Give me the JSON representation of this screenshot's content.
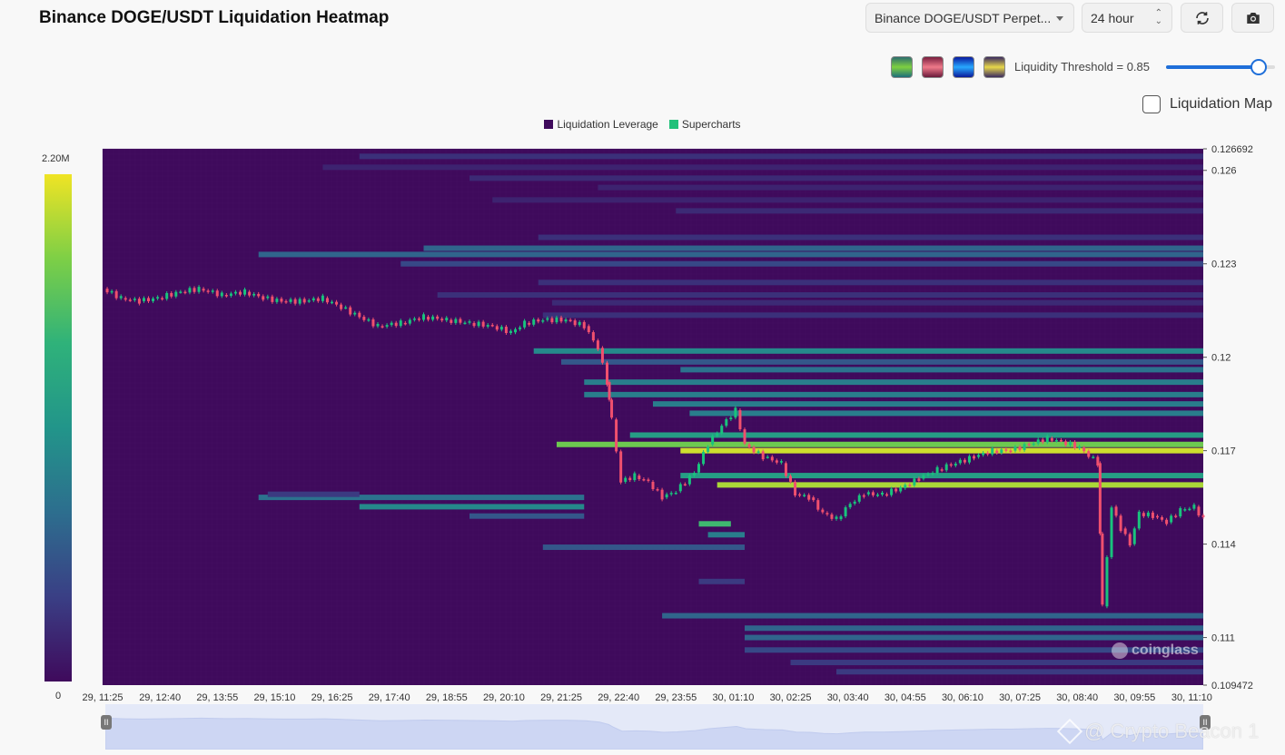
{
  "header": {
    "title": "Binance DOGE/USDT Liquidation Heatmap",
    "symbol_select": "Binance DOGE/USDT Perpet...",
    "range_select": "24 hour",
    "refresh_icon": "refresh-icon",
    "camera_icon": "camera-icon"
  },
  "controls": {
    "palette_swatches": [
      "viridis-palette",
      "red-palette",
      "blue-palette",
      "yellow-palette"
    ],
    "threshold_label": "Liquidity Threshold = 0.85",
    "threshold_value": 0.85,
    "liquidation_map_label": "Liquidation Map",
    "liquidation_map_checked": false
  },
  "colorbar": {
    "max_label": "2.20M",
    "min_label": "0",
    "max_value": 2200000,
    "min_value": 0
  },
  "watermark": "coinglass",
  "credit": "@ Crypto Beacon 1",
  "chart_data": {
    "type": "heatmap",
    "title": "Binance DOGE/USDT Liquidation Heatmap",
    "legend": [
      {
        "name": "Liquidation Leverage",
        "color": "#3f0a5c"
      },
      {
        "name": "Supercharts",
        "color": "#22c17a"
      }
    ],
    "legend_position": "top-center",
    "x_ticks": [
      "29, 11:25",
      "29, 12:40",
      "29, 13:55",
      "29, 15:10",
      "29, 16:25",
      "29, 17:40",
      "29, 18:55",
      "29, 20:10",
      "29, 21:25",
      "29, 22:40",
      "29, 23:55",
      "30, 01:10",
      "30, 02:25",
      "30, 03:40",
      "30, 04:55",
      "30, 06:10",
      "30, 07:25",
      "30, 08:40",
      "30, 09:55",
      "30, 11:10"
    ],
    "y_ticks": [
      "0.126692",
      "0.126",
      "0.123",
      "0.12",
      "0.117",
      "0.114",
      "0.111",
      "0.109472"
    ],
    "ylim": [
      0.109472,
      0.126692
    ],
    "x_range_hours": [
      0,
      24
    ],
    "colorscale": [
      "#3f0a5c",
      "#3a3f85",
      "#2d6e8e",
      "#22958a",
      "#2fb27a",
      "#7dcf46",
      "#f0e424"
    ],
    "bands": [
      {
        "price": 0.12645,
        "start": 5.6,
        "end": 24,
        "intensity": 0.12
      },
      {
        "price": 0.1261,
        "start": 4.8,
        "end": 24,
        "intensity": 0.08
      },
      {
        "price": 0.12575,
        "start": 8.0,
        "end": 24,
        "intensity": 0.1
      },
      {
        "price": 0.12545,
        "start": 10.8,
        "end": 24,
        "intensity": 0.08
      },
      {
        "price": 0.12505,
        "start": 8.5,
        "end": 24,
        "intensity": 0.08
      },
      {
        "price": 0.1247,
        "start": 12.5,
        "end": 24,
        "intensity": 0.1
      },
      {
        "price": 0.12385,
        "start": 9.5,
        "end": 24,
        "intensity": 0.12
      },
      {
        "price": 0.1235,
        "start": 7.0,
        "end": 24,
        "intensity": 0.3
      },
      {
        "price": 0.1233,
        "start": 3.4,
        "end": 24,
        "intensity": 0.3
      },
      {
        "price": 0.123,
        "start": 6.5,
        "end": 24,
        "intensity": 0.2
      },
      {
        "price": 0.1224,
        "start": 9.5,
        "end": 24,
        "intensity": 0.12
      },
      {
        "price": 0.122,
        "start": 7.3,
        "end": 24,
        "intensity": 0.12
      },
      {
        "price": 0.12175,
        "start": 9.8,
        "end": 24,
        "intensity": 0.1
      },
      {
        "price": 0.12135,
        "start": 9.6,
        "end": 24,
        "intensity": 0.12
      },
      {
        "price": 0.1202,
        "start": 9.4,
        "end": 24,
        "intensity": 0.45
      },
      {
        "price": 0.11985,
        "start": 10.0,
        "end": 24,
        "intensity": 0.25
      },
      {
        "price": 0.1196,
        "start": 12.6,
        "end": 24,
        "intensity": 0.35
      },
      {
        "price": 0.1192,
        "start": 10.5,
        "end": 24,
        "intensity": 0.4
      },
      {
        "price": 0.1188,
        "start": 10.5,
        "end": 24,
        "intensity": 0.4
      },
      {
        "price": 0.1185,
        "start": 12.0,
        "end": 24,
        "intensity": 0.4
      },
      {
        "price": 0.1182,
        "start": 12.8,
        "end": 24,
        "intensity": 0.4
      },
      {
        "price": 0.1175,
        "start": 11.5,
        "end": 24,
        "intensity": 0.55
      },
      {
        "price": 0.1172,
        "start": 9.9,
        "end": 24,
        "intensity": 0.8
      },
      {
        "price": 0.117,
        "start": 12.6,
        "end": 24,
        "intensity": 0.95
      },
      {
        "price": 0.1162,
        "start": 12.6,
        "end": 24,
        "intensity": 0.55
      },
      {
        "price": 0.1159,
        "start": 13.4,
        "end": 24,
        "intensity": 0.9
      },
      {
        "price": 0.1155,
        "start": 3.4,
        "end": 10.5,
        "intensity": 0.35
      },
      {
        "price": 0.1152,
        "start": 5.6,
        "end": 10.5,
        "intensity": 0.45
      },
      {
        "price": 0.1149,
        "start": 8.0,
        "end": 10.5,
        "intensity": 0.25
      },
      {
        "price": 0.11465,
        "start": 13.0,
        "end": 13.7,
        "intensity": 0.7
      },
      {
        "price": 0.1143,
        "start": 13.2,
        "end": 14.0,
        "intensity": 0.4
      },
      {
        "price": 0.1139,
        "start": 9.6,
        "end": 14.0,
        "intensity": 0.25
      },
      {
        "price": 0.1156,
        "start": 3.6,
        "end": 5.6,
        "intensity": 0.15
      },
      {
        "price": 0.1128,
        "start": 13.0,
        "end": 14.0,
        "intensity": 0.15
      },
      {
        "price": 0.1117,
        "start": 12.2,
        "end": 24,
        "intensity": 0.3
      },
      {
        "price": 0.1113,
        "start": 14.0,
        "end": 24,
        "intensity": 0.3
      },
      {
        "price": 0.111,
        "start": 14.0,
        "end": 24,
        "intensity": 0.3
      },
      {
        "price": 0.1106,
        "start": 14.0,
        "end": 24,
        "intensity": 0.2
      },
      {
        "price": 0.1102,
        "start": 15.0,
        "end": 24,
        "intensity": 0.15
      },
      {
        "price": 0.1099,
        "start": 16.0,
        "end": 24,
        "intensity": 0.15
      }
    ],
    "price_series": [
      {
        "t": 0.0,
        "p": 0.1222
      },
      {
        "t": 0.4,
        "p": 0.1219
      },
      {
        "t": 0.8,
        "p": 0.1218
      },
      {
        "t": 1.2,
        "p": 0.1219
      },
      {
        "t": 1.7,
        "p": 0.1221
      },
      {
        "t": 2.1,
        "p": 0.1222
      },
      {
        "t": 2.6,
        "p": 0.122
      },
      {
        "t": 3.1,
        "p": 0.1221
      },
      {
        "t": 3.5,
        "p": 0.1219
      },
      {
        "t": 3.9,
        "p": 0.1218
      },
      {
        "t": 4.4,
        "p": 0.1218
      },
      {
        "t": 4.8,
        "p": 0.1219
      },
      {
        "t": 5.2,
        "p": 0.1216
      },
      {
        "t": 5.6,
        "p": 0.1213
      },
      {
        "t": 6.0,
        "p": 0.121
      },
      {
        "t": 6.5,
        "p": 0.1211
      },
      {
        "t": 7.0,
        "p": 0.1213
      },
      {
        "t": 7.5,
        "p": 0.1212
      },
      {
        "t": 8.0,
        "p": 0.1211
      },
      {
        "t": 8.5,
        "p": 0.121
      },
      {
        "t": 8.9,
        "p": 0.1208
      },
      {
        "t": 9.2,
        "p": 0.1211
      },
      {
        "t": 9.6,
        "p": 0.1212
      },
      {
        "t": 10.1,
        "p": 0.1212
      },
      {
        "t": 10.5,
        "p": 0.121
      },
      {
        "t": 10.8,
        "p": 0.1203
      },
      {
        "t": 11.0,
        "p": 0.1192
      },
      {
        "t": 11.1,
        "p": 0.118
      },
      {
        "t": 11.3,
        "p": 0.116
      },
      {
        "t": 11.6,
        "p": 0.1162
      },
      {
        "t": 11.9,
        "p": 0.116
      },
      {
        "t": 12.2,
        "p": 0.1155
      },
      {
        "t": 12.5,
        "p": 0.1157
      },
      {
        "t": 12.9,
        "p": 0.1163
      },
      {
        "t": 13.2,
        "p": 0.1172
      },
      {
        "t": 13.5,
        "p": 0.1178
      },
      {
        "t": 13.8,
        "p": 0.1183
      },
      {
        "t": 14.0,
        "p": 0.1172
      },
      {
        "t": 14.4,
        "p": 0.1168
      },
      {
        "t": 14.8,
        "p": 0.1166
      },
      {
        "t": 15.1,
        "p": 0.1156
      },
      {
        "t": 15.4,
        "p": 0.1155
      },
      {
        "t": 15.7,
        "p": 0.115
      },
      {
        "t": 16.0,
        "p": 0.1148
      },
      {
        "t": 16.3,
        "p": 0.1153
      },
      {
        "t": 16.6,
        "p": 0.1156
      },
      {
        "t": 17.0,
        "p": 0.1156
      },
      {
        "t": 17.4,
        "p": 0.1158
      },
      {
        "t": 17.8,
        "p": 0.1161
      },
      {
        "t": 18.2,
        "p": 0.1164
      },
      {
        "t": 18.6,
        "p": 0.1166
      },
      {
        "t": 19.0,
        "p": 0.1168
      },
      {
        "t": 19.4,
        "p": 0.117
      },
      {
        "t": 19.8,
        "p": 0.117
      },
      {
        "t": 20.2,
        "p": 0.1172
      },
      {
        "t": 20.6,
        "p": 0.1174
      },
      {
        "t": 20.9,
        "p": 0.1173
      },
      {
        "t": 21.3,
        "p": 0.1171
      },
      {
        "t": 21.7,
        "p": 0.1166
      },
      {
        "t": 21.8,
        "p": 0.112
      },
      {
        "t": 22.0,
        "p": 0.1152
      },
      {
        "t": 22.2,
        "p": 0.1145
      },
      {
        "t": 22.4,
        "p": 0.114
      },
      {
        "t": 22.6,
        "p": 0.115
      },
      {
        "t": 22.9,
        "p": 0.1149
      },
      {
        "t": 23.2,
        "p": 0.1147
      },
      {
        "t": 23.5,
        "p": 0.1151
      },
      {
        "t": 23.8,
        "p": 0.1152
      },
      {
        "t": 24.0,
        "p": 0.1148
      }
    ]
  }
}
